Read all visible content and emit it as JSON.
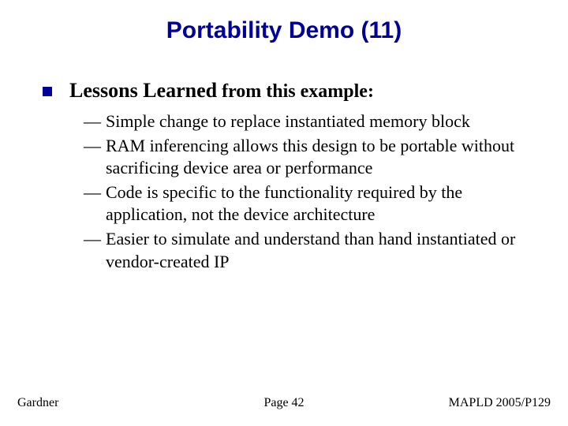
{
  "title": "Portability Demo (11)",
  "heading": {
    "bold": "Lessons Learned",
    "tail": " from this example:"
  },
  "subitems": [
    "Simple change to replace instantiated memory block",
    "RAM inferencing allows this design to be portable without sacrificing device area or performance",
    "Code is specific to the functionality required by the application, not the device architecture",
    "Easier to simulate and understand than hand instantiated or vendor-created IP"
  ],
  "footer": {
    "left": "Gardner",
    "center": "Page 42",
    "right": "MAPLD 2005/P129"
  },
  "bullet_dash": "—"
}
